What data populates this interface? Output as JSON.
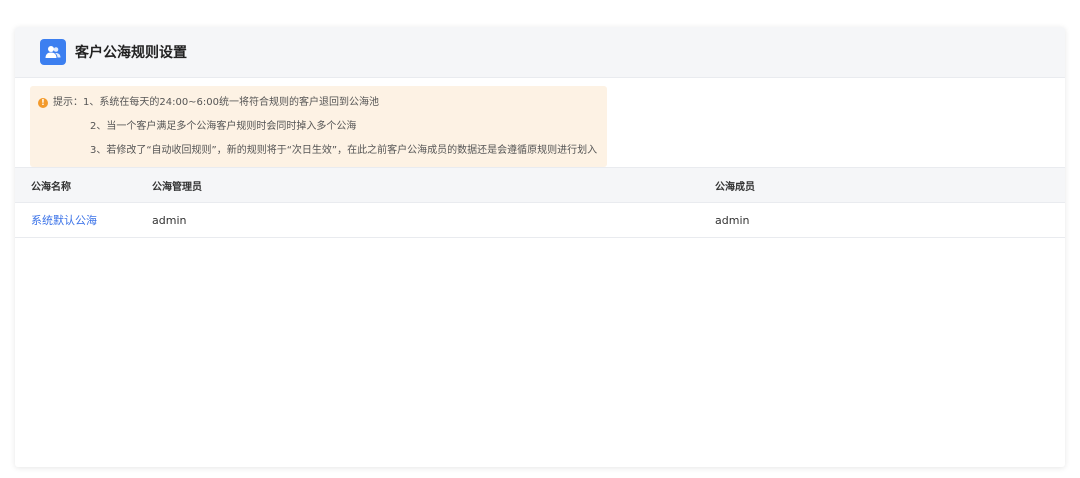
{
  "header": {
    "title": "客户公海规则设置",
    "icon": "users-icon"
  },
  "notice": {
    "prefix": "提示：",
    "lines": [
      "1、系统在每天的24:00~6:00统一将符合规则的客户退回到公海池",
      "2、当一个客户满足多个公海客户规则时会同时掉入多个公海",
      "3、若修改了“自动收回规则”，新的规则将于“次日生效”，在此之前客户公海成员的数据还是会遵循原规则进行划入"
    ]
  },
  "table": {
    "columns": [
      "公海名称",
      "公海管理员",
      "公海成员"
    ],
    "rows": [
      {
        "name": "系统默认公海",
        "admin": "admin",
        "members": "admin"
      }
    ]
  },
  "colors": {
    "accent": "#3c7ff0",
    "link": "#3a72e8",
    "notice_bg": "#fdf2e4",
    "warning": "#f39a2b"
  }
}
